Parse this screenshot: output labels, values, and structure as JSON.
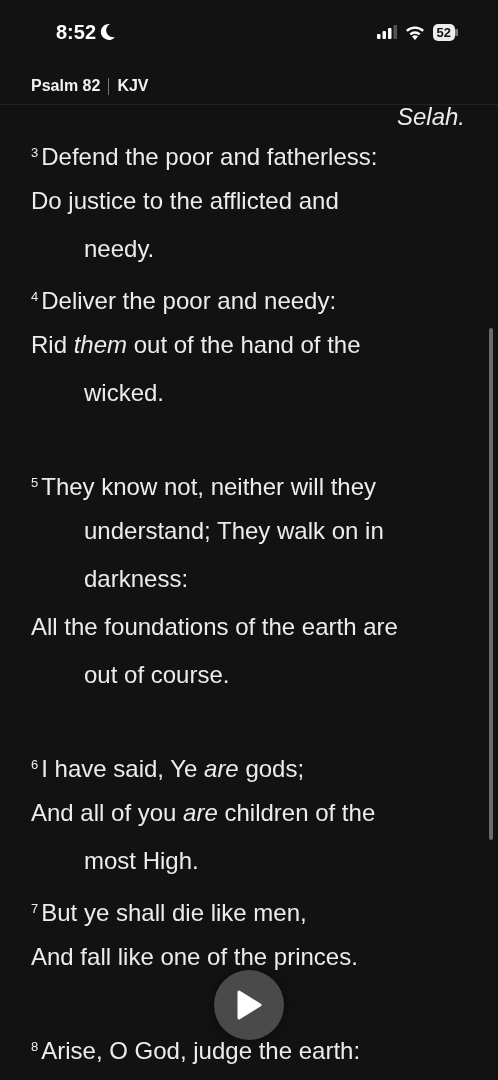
{
  "status_bar": {
    "time": "8:52",
    "battery": "52"
  },
  "header": {
    "book": "Psalm 82",
    "version": "KJV"
  },
  "lines": [
    {
      "kind": "selah",
      "text": "Selah."
    },
    {
      "kind": "first",
      "verse": "3",
      "text": "Defend the poor and fatherless:"
    },
    {
      "kind": "cont",
      "text": "Do justice to the afflicted and"
    },
    {
      "kind": "indent",
      "text": "needy."
    },
    {
      "kind": "first",
      "verse": "4",
      "text": "Deliver the poor and needy:"
    },
    {
      "kind": "cont",
      "text": "Rid *them* out of the hand of the"
    },
    {
      "kind": "indent",
      "text": "wicked."
    },
    {
      "kind": "gap"
    },
    {
      "kind": "first",
      "verse": "5",
      "text": "They know not, neither will they"
    },
    {
      "kind": "indent",
      "text": "understand; They walk on in"
    },
    {
      "kind": "indent",
      "text": "darkness:"
    },
    {
      "kind": "cont",
      "text": "All the foundations of the earth are"
    },
    {
      "kind": "indent",
      "text": "out of course."
    },
    {
      "kind": "gap"
    },
    {
      "kind": "first",
      "verse": "6",
      "text": "I have said, Ye *are* gods;"
    },
    {
      "kind": "cont",
      "text": "And all of you *are* children of the"
    },
    {
      "kind": "indent",
      "text": "most High."
    },
    {
      "kind": "first",
      "verse": "7",
      "text": "But ye shall die like men,"
    },
    {
      "kind": "cont",
      "text": "And fall like one of the princes."
    },
    {
      "kind": "gap"
    },
    {
      "kind": "first",
      "verse": "8",
      "text": "Arise, O God, judge the earth:"
    }
  ]
}
